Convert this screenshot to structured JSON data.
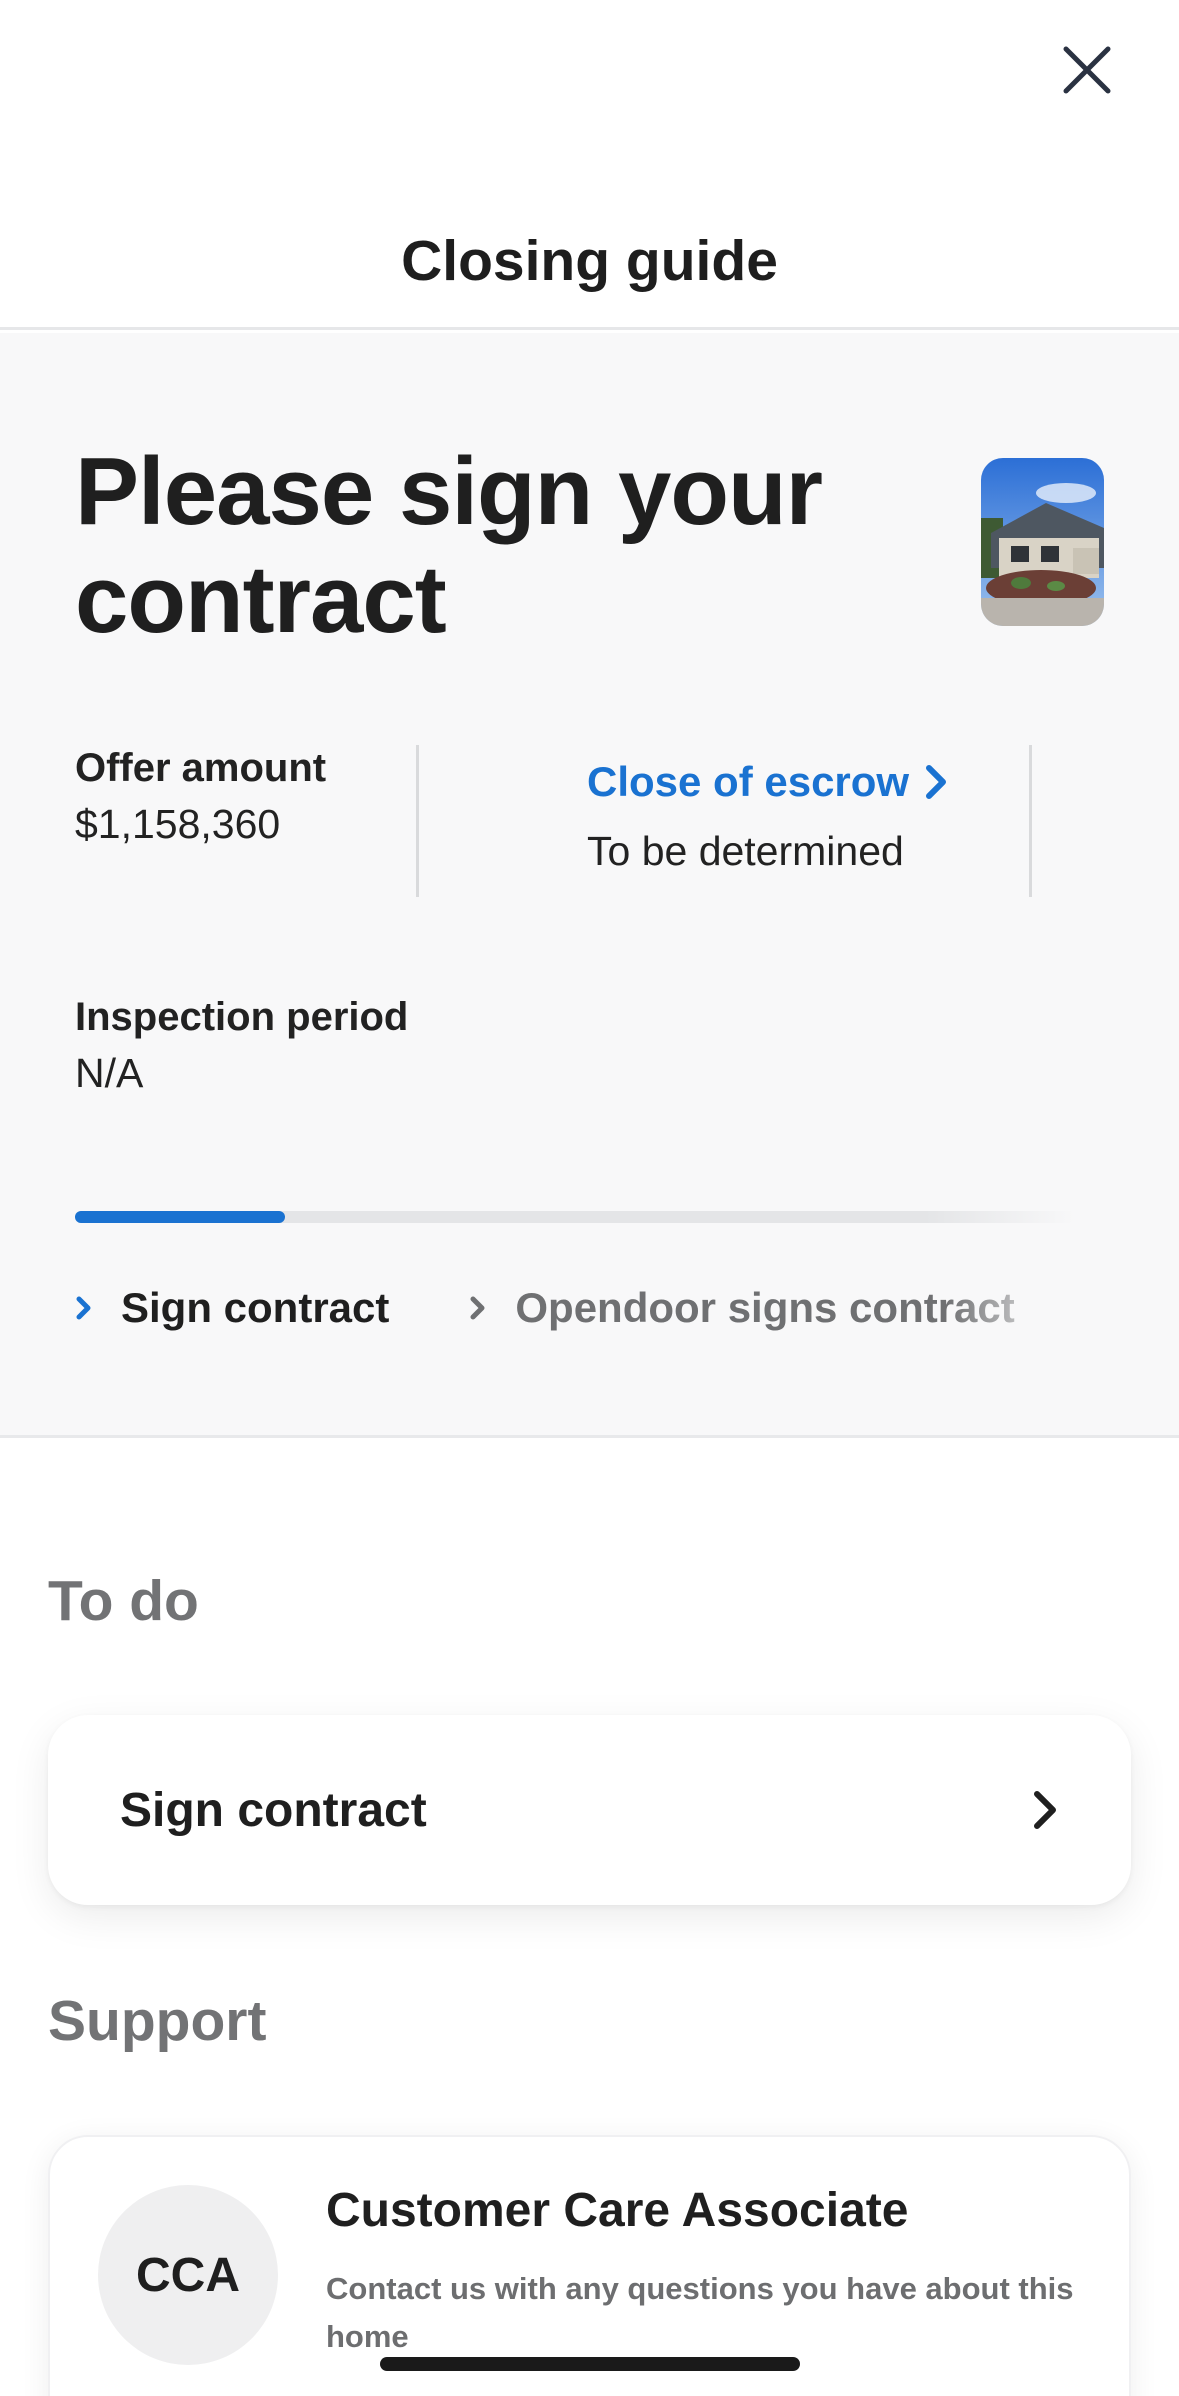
{
  "header": {
    "title": "Closing guide",
    "close_icon": "close-icon"
  },
  "hero": {
    "heading": "Please sign your contract",
    "thumbnail": "house-photo",
    "offer": {
      "label": "Offer amount",
      "value": "$1,158,360"
    },
    "escrow": {
      "label": "Close of escrow",
      "value": "To be determined"
    },
    "inspection": {
      "label": "Inspection period",
      "value": "N/A"
    },
    "progress": 0.21,
    "steps": [
      {
        "label": "Sign contract",
        "state": "active"
      },
      {
        "label": "Opendoor signs contract",
        "state": "upcoming"
      }
    ]
  },
  "todo": {
    "heading": "To do",
    "items": [
      {
        "label": "Sign contract"
      }
    ]
  },
  "support": {
    "heading": "Support",
    "avatar_initials": "CCA",
    "title": "Customer Care Associate",
    "description": "Contact us with any questions you have about this home"
  },
  "colors": {
    "accent": "#1a72d1",
    "hero_bg": "#f8f8f9",
    "muted_heading": "#727375"
  }
}
